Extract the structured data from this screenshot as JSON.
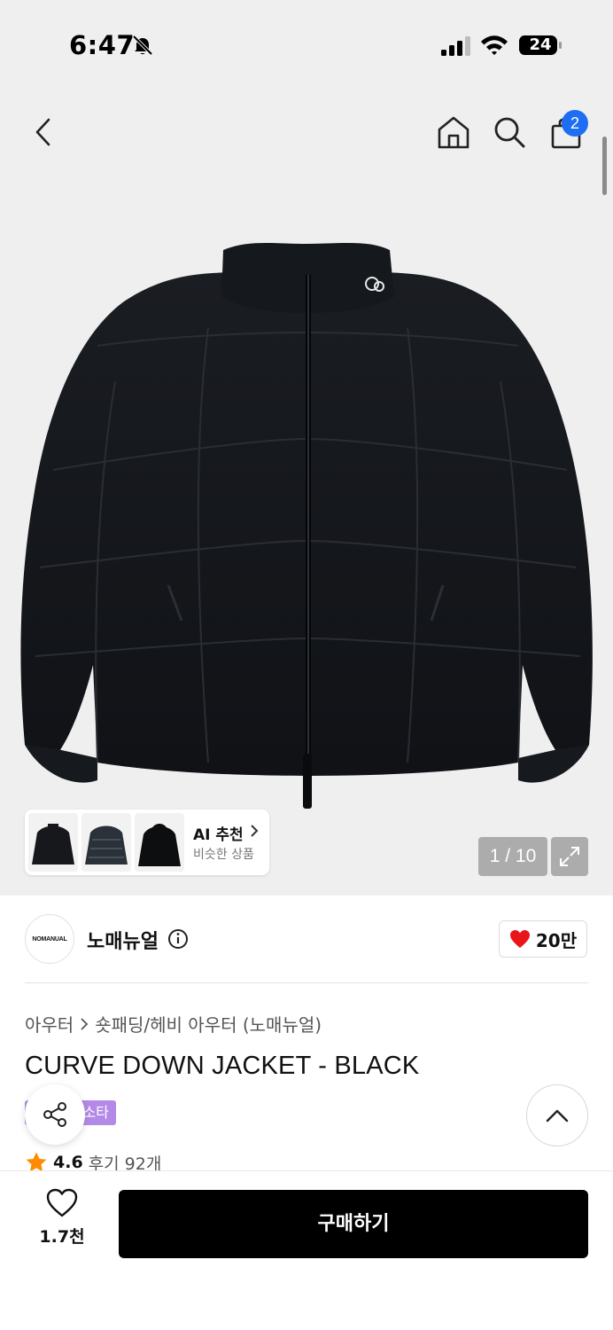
{
  "status_bar": {
    "time": "6:47",
    "battery": "24"
  },
  "top_nav": {
    "cart_badge": "2",
    "icons": [
      "back-icon",
      "home-icon",
      "search-icon",
      "shopping-bag-icon"
    ]
  },
  "gallery": {
    "page_indicator": "1 / 10",
    "ai_recommend": {
      "title": "AI 추천",
      "subtitle": "비슷한 상품"
    }
  },
  "brand": {
    "logo_text": "NOMANUAL",
    "name": "노매뉴얼",
    "like_count": "20만"
  },
  "breadcrumb": {
    "category": "아우터",
    "subcategory": "숏패딩/헤비 아우터 (노매뉴얼)"
  },
  "product": {
    "title": "CURVE DOWN JACKET - BLACK",
    "tag": "소타",
    "rating": "4.6",
    "review_label": "후기 92개"
  },
  "bottom_bar": {
    "wish_count": "1.7천",
    "buy_label": "구매하기"
  },
  "colors": {
    "accent_blue": "#1d6ef5",
    "tag_purple": "#b48ae8",
    "heart_red": "#e8151b",
    "star_orange": "#ff8c00",
    "buy_button": "#000000"
  }
}
